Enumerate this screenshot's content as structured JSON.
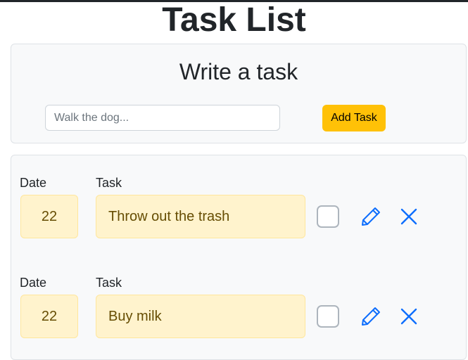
{
  "page": {
    "title": "Task List"
  },
  "write_card": {
    "heading": "Write a task",
    "input_placeholder": "Walk the dog...",
    "add_button_label": "Add Task"
  },
  "tasks": [
    {
      "date_label": "Date",
      "task_label": "Task",
      "date": "22",
      "task": "Throw out the trash",
      "done": false,
      "edit_icon": "pencil-icon",
      "delete_icon": "close-icon"
    },
    {
      "date_label": "Date",
      "task_label": "Task",
      "date": "22",
      "task": "Buy milk",
      "done": false,
      "edit_icon": "pencil-icon",
      "delete_icon": "close-icon"
    }
  ],
  "colors": {
    "accent_warning": "#ffc107",
    "task_field_bg": "#fff3cd",
    "task_field_text": "#664d03",
    "icon_primary": "#0d6efd"
  }
}
